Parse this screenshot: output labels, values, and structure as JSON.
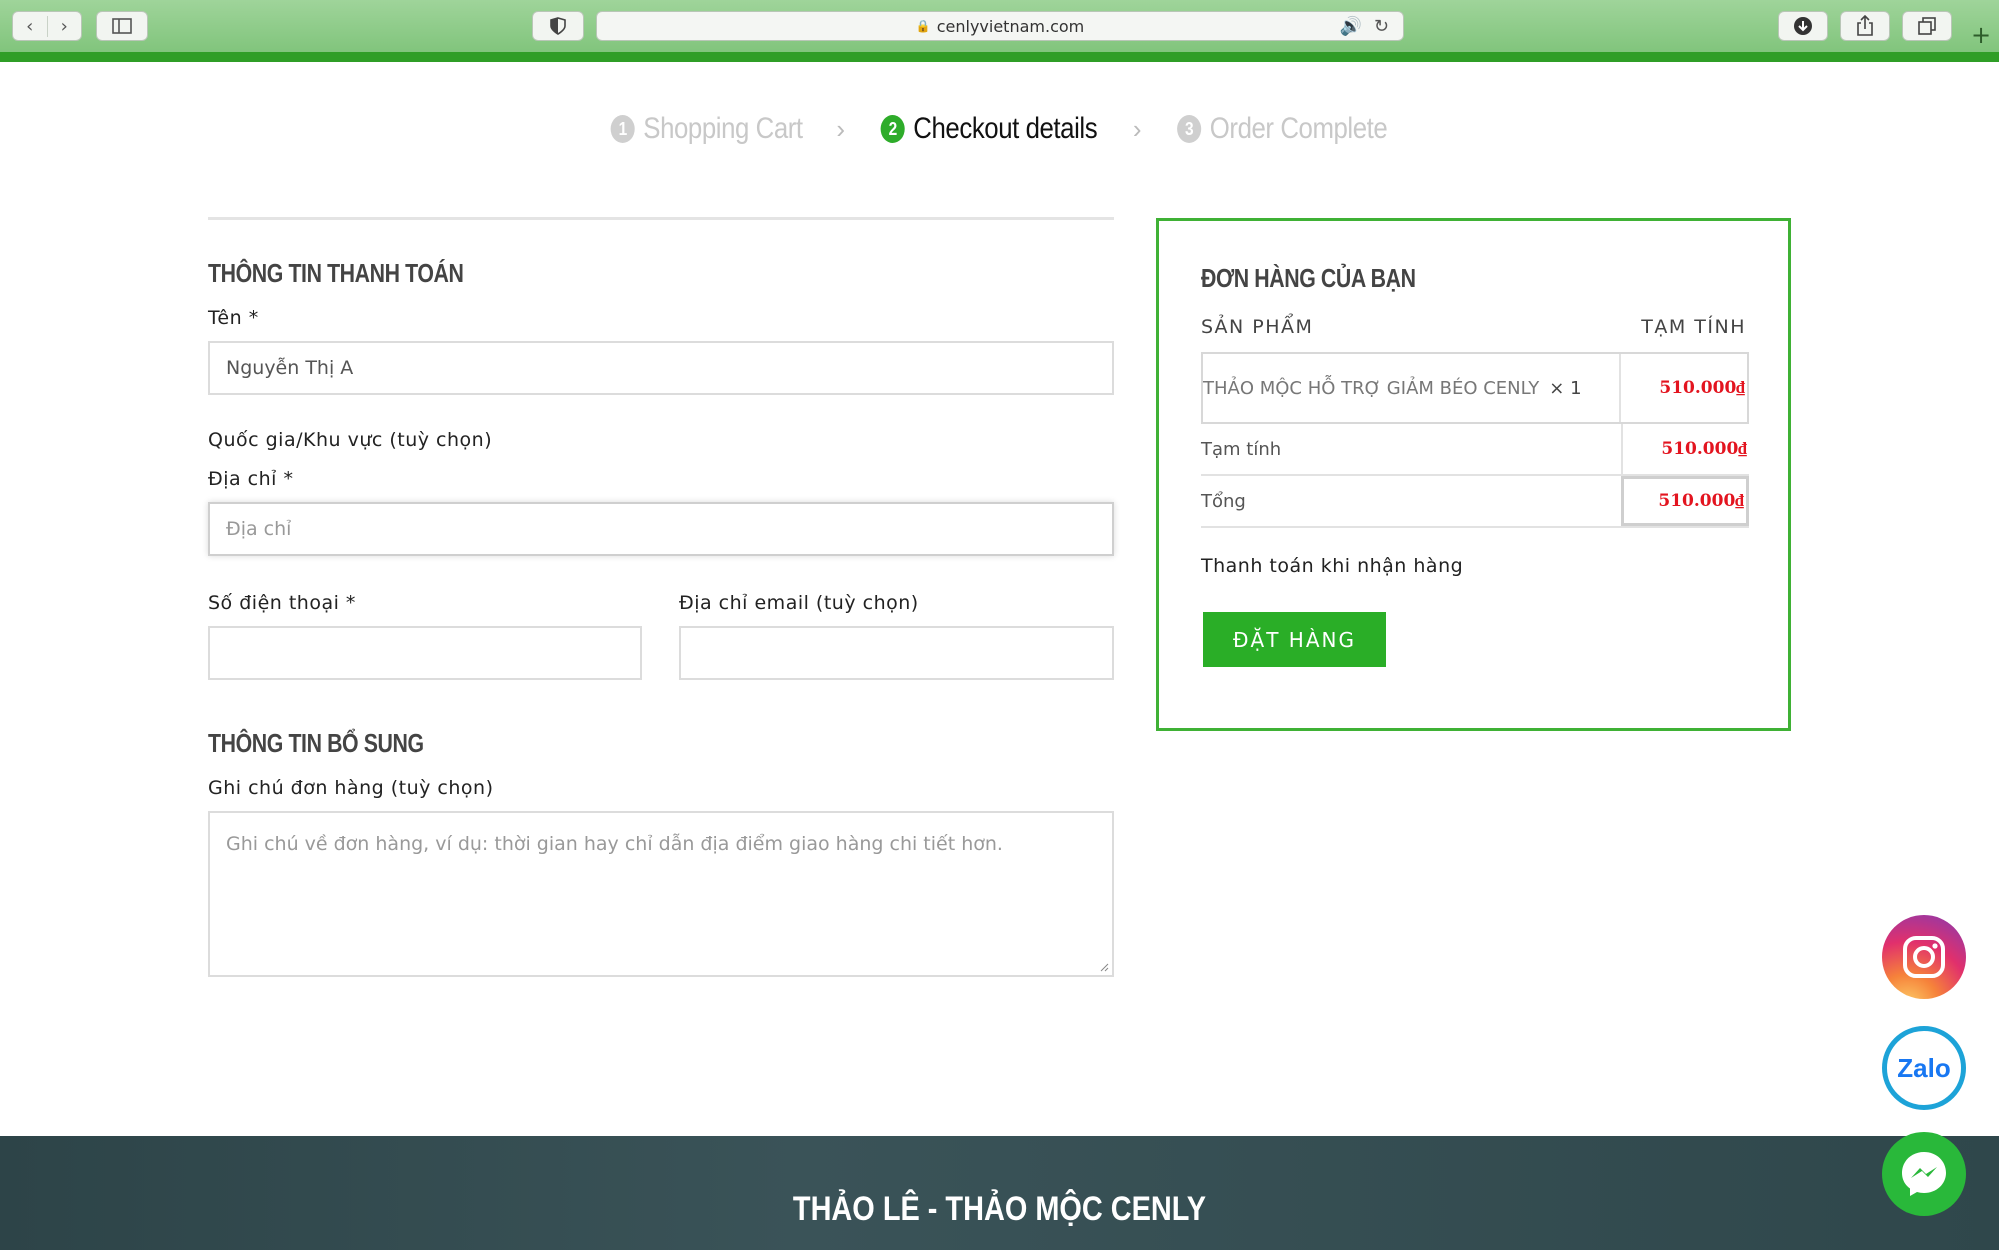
{
  "browser": {
    "url": "cenlyvietnam.com",
    "back_glyph": "‹",
    "forward_glyph": "›"
  },
  "steps": [
    {
      "num": "1",
      "label": "Shopping Cart",
      "state": "done"
    },
    {
      "num": "2",
      "label": "Checkout details",
      "state": "active"
    },
    {
      "num": "3",
      "label": "Order Complete",
      "state": "pending"
    }
  ],
  "billing": {
    "title": "THÔNG TIN THANH TOÁN",
    "name_label": "Tên *",
    "name_value": "Nguyễn Thị A",
    "country_label": "Quốc gia/Khu vực (tuỳ chọn)",
    "address_label": "Địa chỉ *",
    "address_placeholder": "Địa chỉ",
    "phone_label": "Số điện thoại *",
    "phone_value": "",
    "email_label": "Địa chỉ email (tuỳ chọn)",
    "email_value": ""
  },
  "additional": {
    "title": "THÔNG TIN BỔ SUNG",
    "notes_label": "Ghi chú đơn hàng (tuỳ chọn)",
    "notes_placeholder": "Ghi chú về đơn hàng, ví dụ: thời gian hay chỉ dẫn địa điểm giao hàng chi tiết hơn."
  },
  "order": {
    "title": "ĐƠN HÀNG CỦA BẠN",
    "col_product": "SẢN PHẨM",
    "col_subtotal": "TẠM TÍNH",
    "item_name": "THẢO MỘC HỖ TRỢ GIẢM BÉO CENLY",
    "item_qty": "× 1",
    "item_price": "510.000₫",
    "subtotal_label": "Tạm tính",
    "subtotal_value": "510.000₫",
    "total_label": "Tổng",
    "total_value": "510.000₫",
    "payment_method": "Thanh toán khi nhận hàng",
    "place_order": "ĐẶT HÀNG"
  },
  "footer": {
    "title": "THẢO LÊ - THẢO MỘC CENLY"
  },
  "floating": {
    "zalo_label": "Zalo"
  },
  "colors": {
    "accent": "#2aae27",
    "price": "#e3141f",
    "footer_bg": "#2d4448"
  }
}
